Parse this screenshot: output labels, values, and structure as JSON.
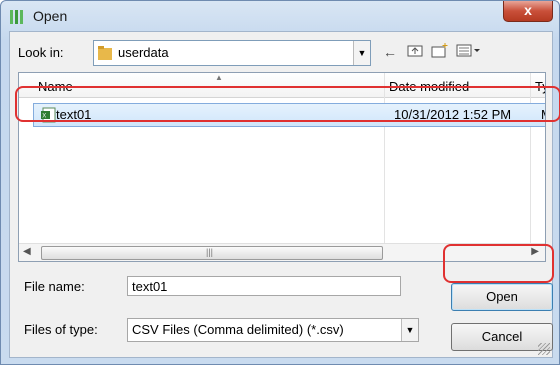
{
  "window": {
    "title": "Open",
    "close_glyph": "x"
  },
  "lookin": {
    "label": "Look in:",
    "value": "userdata"
  },
  "toolbar": {
    "back_icon": "back-arrow-icon",
    "up_icon": "up-folder-icon",
    "newfolder_icon": "new-folder-icon",
    "views_icon": "view-menu-icon"
  },
  "list": {
    "columns": [
      "Name",
      "Date modified",
      "Ty"
    ],
    "rows": [
      {
        "name": "text01",
        "date": "10/31/2012 1:52 PM",
        "type": "M"
      }
    ]
  },
  "filename": {
    "label": "File name:",
    "value": "text01"
  },
  "filetype": {
    "label": "Files of type:",
    "value": "CSV Files (Comma delimited) (*.csv)"
  },
  "buttons": {
    "open": "Open",
    "cancel": "Cancel"
  },
  "colors": {
    "highlight": "#e03131",
    "selection": "#cfe6fb"
  }
}
